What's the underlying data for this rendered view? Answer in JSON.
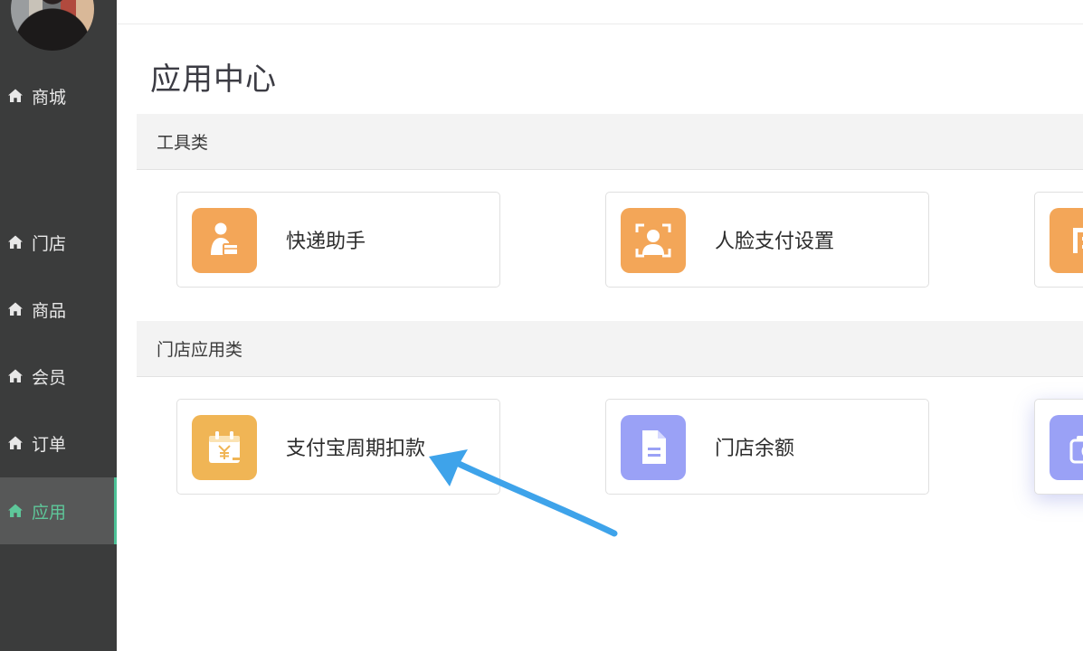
{
  "sidebar": {
    "items": [
      {
        "label": "商城"
      },
      {
        "label": "门店"
      },
      {
        "label": "商品"
      },
      {
        "label": "会员"
      },
      {
        "label": "订单"
      },
      {
        "label": "应用"
      }
    ],
    "active_index": 5
  },
  "main": {
    "title": "应用中心",
    "sections": [
      {
        "title": "工具类",
        "cards": [
          {
            "label": "快递助手",
            "icon": "courier-icon"
          },
          {
            "label": "人脸支付设置",
            "icon": "face-pay-icon"
          },
          {
            "label": "",
            "icon": "partial-app-icon"
          }
        ]
      },
      {
        "title": "门店应用类",
        "cards": [
          {
            "label": "支付宝周期扣款",
            "icon": "calendar-yuan-icon"
          },
          {
            "label": "门店余额",
            "icon": "document-icon"
          },
          {
            "label": "",
            "icon": "camera-icon"
          }
        ]
      }
    ]
  },
  "colors": {
    "sidebar_bg": "#3b3c3c",
    "active_accent": "#4cc196",
    "icon_orange": "#f3a658",
    "icon_yellow": "#f0b555",
    "icon_purple": "#9aa1f6",
    "annotation_arrow": "#3ea3ea"
  }
}
